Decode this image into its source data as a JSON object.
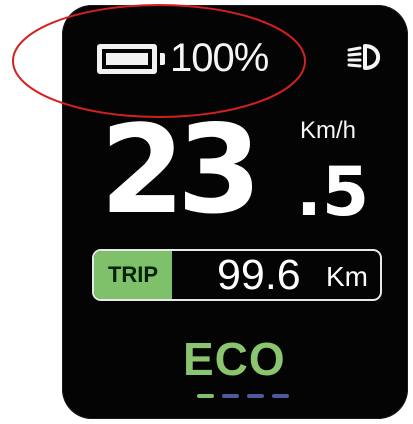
{
  "colors": {
    "display_background": "#040404",
    "text_primary": "#ffffff",
    "accent_green": "#7fc06a",
    "mode_green": "#8bc56f",
    "dash_inactive": "#4d5b9a",
    "highlight_red": "#d42020"
  },
  "status_bar": {
    "battery_icon": "battery-full-icon",
    "battery_level": 1.0,
    "battery_percent": "100%",
    "headlight_icon": "headlight-icon"
  },
  "speed": {
    "integer_part": "23",
    "decimal_part": ".5",
    "unit": "Km/h"
  },
  "trip": {
    "label": "TRIP",
    "value": "99.6",
    "unit": "Km"
  },
  "mode": {
    "label": "ECO",
    "assist_level": 1,
    "assist_levels_total": 4
  }
}
